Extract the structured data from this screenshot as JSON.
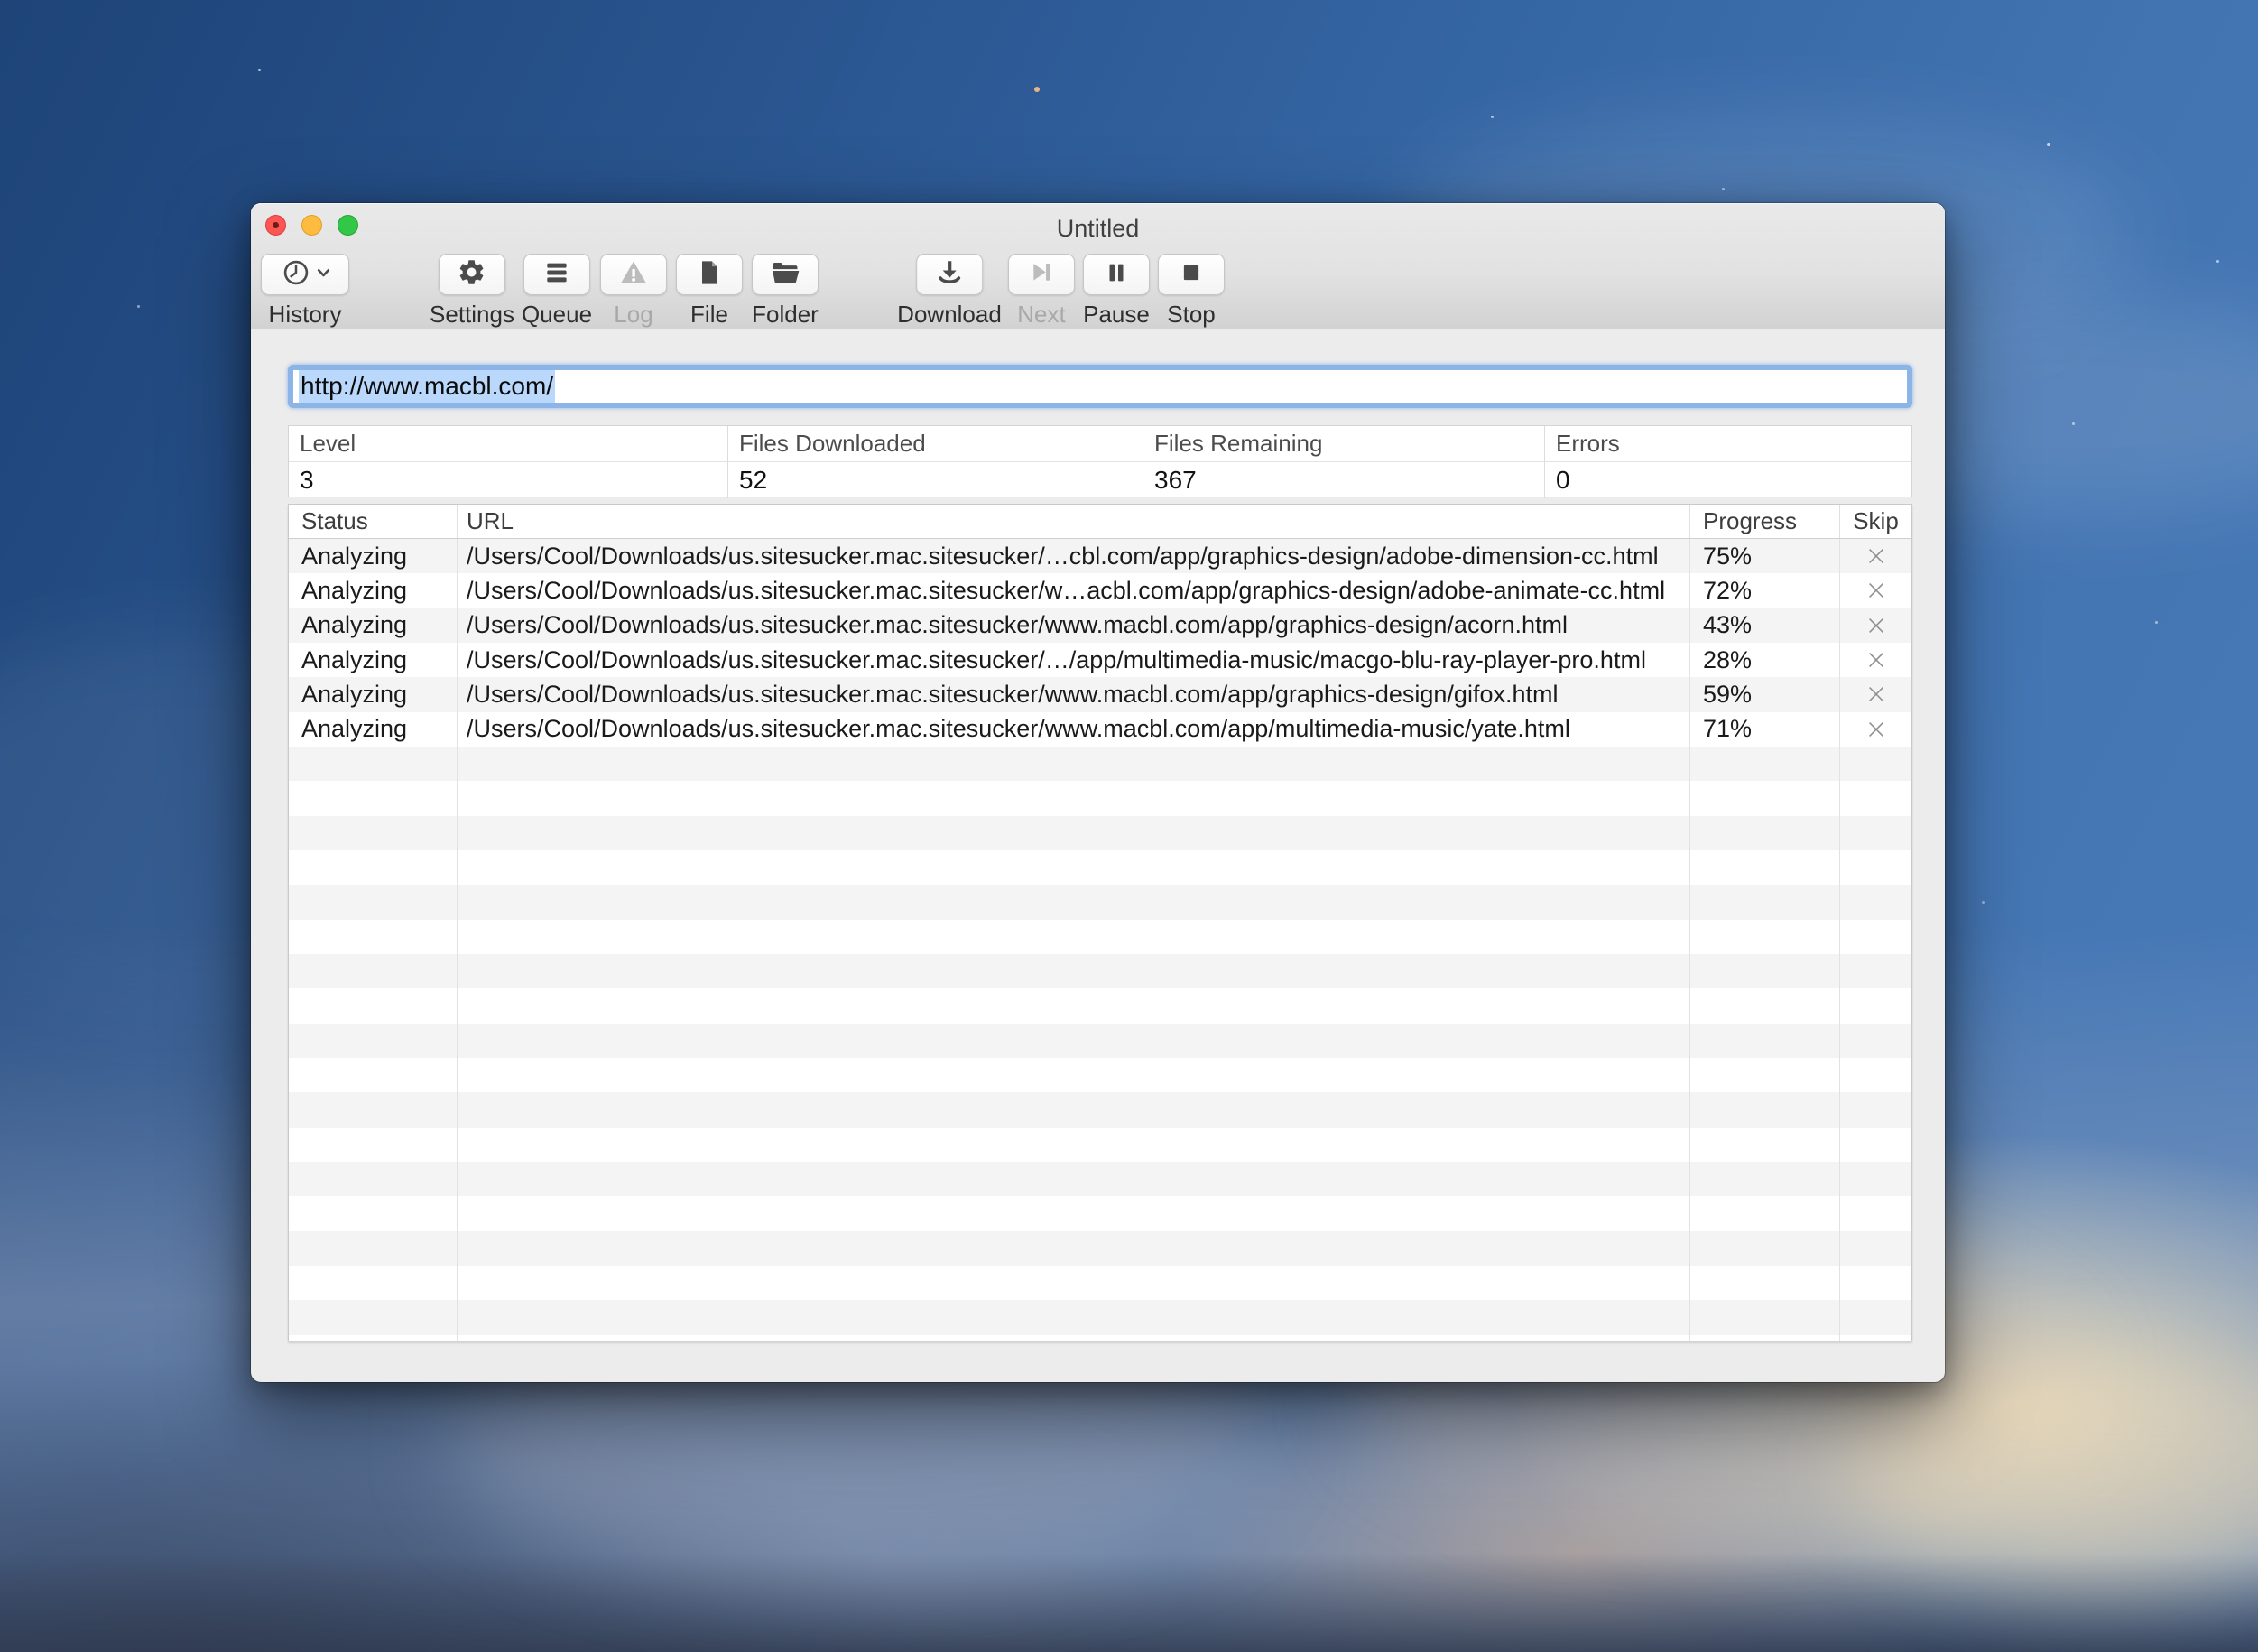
{
  "window": {
    "title": "Untitled",
    "edited_indicator": true
  },
  "toolbar": {
    "items": [
      {
        "label": "History",
        "icon": "history-clock-icon",
        "disabled": false,
        "has_dropdown": true
      },
      {
        "label": "Settings",
        "icon": "gear-icon",
        "disabled": false
      },
      {
        "label": "Queue",
        "icon": "queue-list-icon",
        "disabled": false
      },
      {
        "label": "Log",
        "icon": "warning-triangle-icon",
        "disabled": true
      },
      {
        "label": "File",
        "icon": "file-icon",
        "disabled": false
      },
      {
        "label": "Folder",
        "icon": "folder-icon",
        "disabled": false
      },
      {
        "label": "Download",
        "icon": "download-icon",
        "disabled": false
      },
      {
        "label": "Next",
        "icon": "skip-next-icon",
        "disabled": true
      },
      {
        "label": "Pause",
        "icon": "pause-icon",
        "disabled": false
      },
      {
        "label": "Stop",
        "icon": "stop-icon",
        "disabled": false
      }
    ]
  },
  "url_field": {
    "value": "http://www.macbl.com/",
    "selected": true
  },
  "stats": {
    "columns": [
      {
        "label": "Level",
        "value": "3"
      },
      {
        "label": "Files Downloaded",
        "value": "52"
      },
      {
        "label": "Files Remaining",
        "value": "367"
      },
      {
        "label": "Errors",
        "value": "0"
      }
    ]
  },
  "queue_table": {
    "headers": [
      "Status",
      "URL",
      "Progress",
      "Skip"
    ],
    "rows": [
      {
        "status": "Analyzing",
        "url": "/Users/Cool/Downloads/us.sitesucker.mac.sitesucker/…cbl.com/app/graphics-design/adobe-dimension-cc.html",
        "progress": "75%"
      },
      {
        "status": "Analyzing",
        "url": "/Users/Cool/Downloads/us.sitesucker.mac.sitesucker/w…acbl.com/app/graphics-design/adobe-animate-cc.html",
        "progress": "72%"
      },
      {
        "status": "Analyzing",
        "url": "/Users/Cool/Downloads/us.sitesucker.mac.sitesucker/www.macbl.com/app/graphics-design/acorn.html",
        "progress": "43%"
      },
      {
        "status": "Analyzing",
        "url": "/Users/Cool/Downloads/us.sitesucker.mac.sitesucker/…/app/multimedia-music/macgo-blu-ray-player-pro.html",
        "progress": "28%"
      },
      {
        "status": "Analyzing",
        "url": "/Users/Cool/Downloads/us.sitesucker.mac.sitesucker/www.macbl.com/app/graphics-design/gifox.html",
        "progress": "59%"
      },
      {
        "status": "Analyzing",
        "url": "/Users/Cool/Downloads/us.sitesucker.mac.sitesucker/www.macbl.com/app/multimedia-music/yate.html",
        "progress": "71%"
      }
    ]
  },
  "colors": {
    "selection_highlight": "#b9d8fb",
    "focus_ring": "#8db4e6",
    "row_stripe": "#f4f4f4",
    "traffic_red": "#fc5753",
    "traffic_yellow": "#fdbc40",
    "traffic_green": "#33c748",
    "icon_enabled": "#4b4b4b",
    "icon_disabled": "#bcbcbc"
  }
}
